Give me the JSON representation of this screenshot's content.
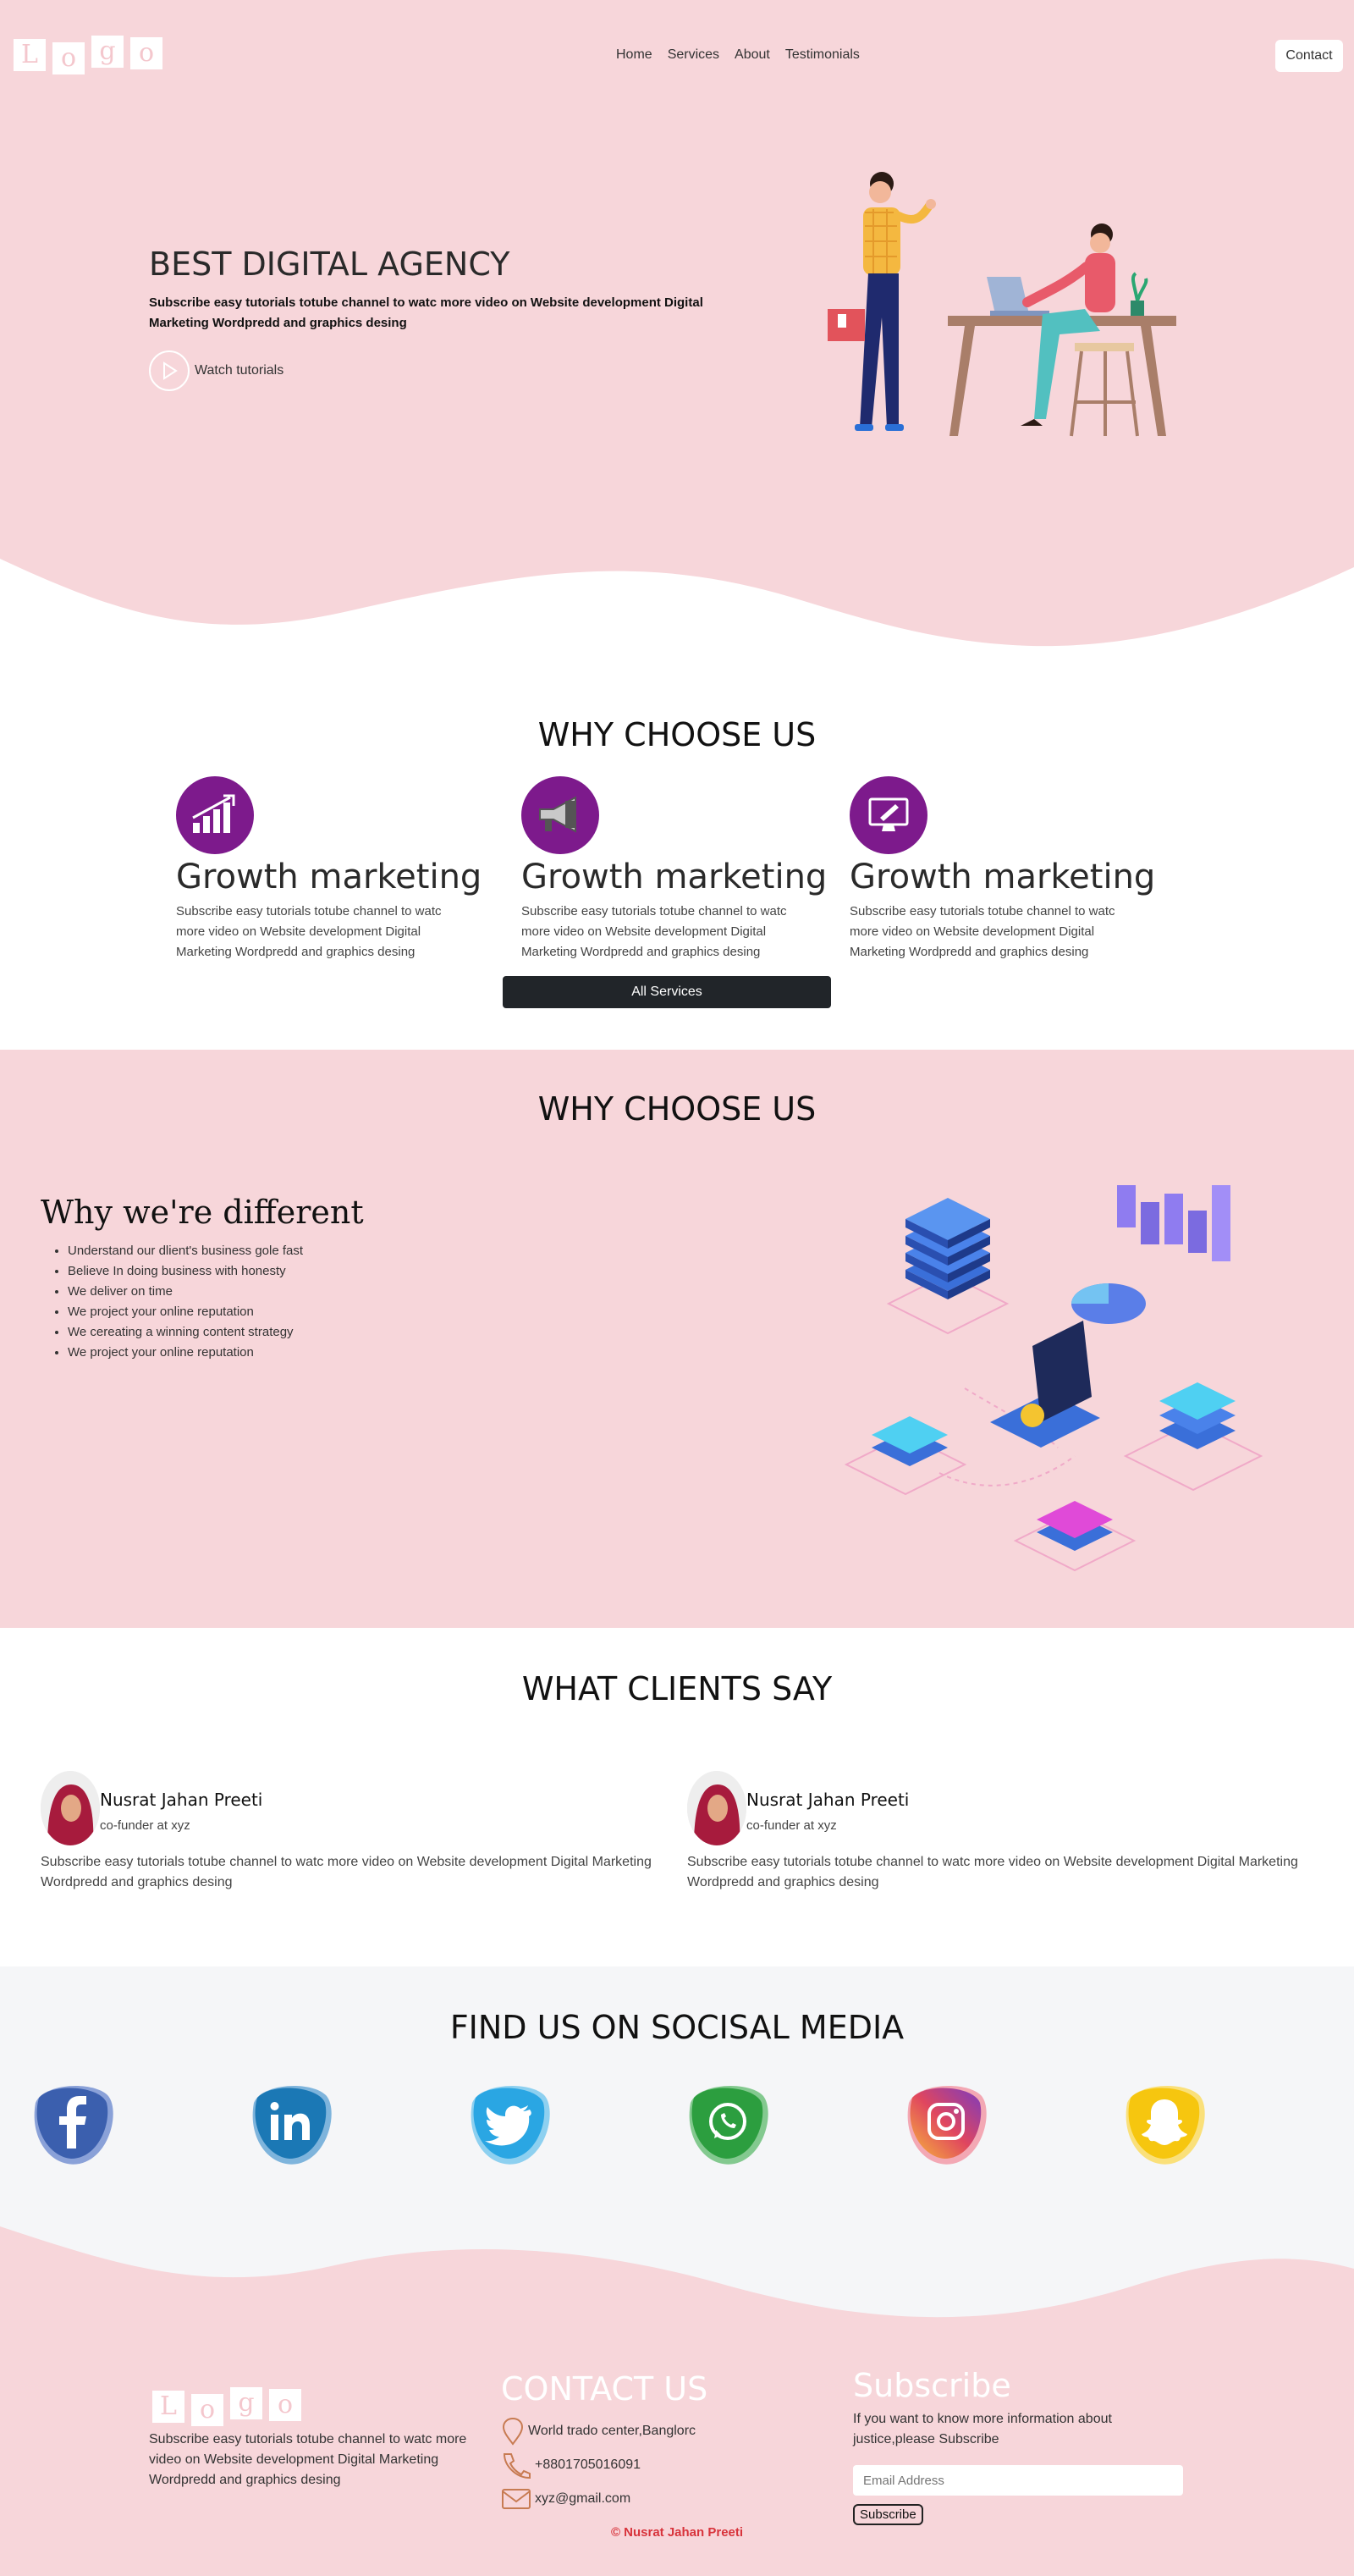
{
  "header": {
    "logo_letters": [
      "L",
      "o",
      "g",
      "o"
    ],
    "nav": [
      "Home",
      "Services",
      "About",
      "Testimonials"
    ],
    "contact_label": "Contact"
  },
  "hero": {
    "title": "BEST DIGITAL AGENCY",
    "subtitle": "Subscribe easy tutorials totube channel to watc more video on Website development Digital Marketing Wordpredd and graphics desing",
    "watch_label": "Watch tutorials"
  },
  "services": {
    "title": "WHY CHOOSE US",
    "items": [
      {
        "icon": "growth-chart-icon",
        "title": "Growth marketing",
        "text": "Subscribe easy tutorials totube channel to watc more video on Website development Digital Marketing Wordpredd and graphics desing"
      },
      {
        "icon": "megaphone-icon",
        "title": "Growth marketing",
        "text": "Subscribe easy tutorials totube channel to watc more video on Website development Digital Marketing Wordpredd and graphics desing"
      },
      {
        "icon": "monitor-pen-icon",
        "title": "Growth marketing",
        "text": "Subscribe easy tutorials totube channel to watc more video on Website development Digital Marketing Wordpredd and graphics desing"
      }
    ],
    "all_label": "All Services"
  },
  "different": {
    "section_title": "WHY CHOOSE US",
    "title": "Why we're different",
    "items": [
      "Understand our dlient's business gole fast",
      "Believe In doing business with honesty",
      "We deliver on time",
      "We project your online reputation",
      "We cereating a winning content strategy",
      "We project your online reputation"
    ]
  },
  "clients": {
    "title": "WHAT CLIENTS SAY",
    "items": [
      {
        "name": "Nusrat Jahan Preeti",
        "role": "co-funder at xyz",
        "text": "Subscribe easy tutorials totube channel to watc more video on Website development Digital Marketing Wordpredd and graphics desing"
      },
      {
        "name": "Nusrat Jahan Preeti",
        "role": "co-funder at xyz",
        "text": "Subscribe easy tutorials totube channel to watc more video on Website development Digital Marketing Wordpredd and graphics desing"
      }
    ]
  },
  "social": {
    "title": "FIND US ON SOCISAL MEDIA",
    "items": [
      {
        "icon": "facebook-icon",
        "color": "#3b5fae"
      },
      {
        "icon": "linkedin-icon",
        "color": "#1b78b5"
      },
      {
        "icon": "twitter-icon",
        "color": "#2aa6e3"
      },
      {
        "icon": "whatsapp-icon",
        "color": "#2c9e3f"
      },
      {
        "icon": "instagram-icon",
        "color": "#e0465f"
      },
      {
        "icon": "snapchat-icon",
        "color": "#f6c60f"
      }
    ]
  },
  "footer": {
    "about_text": "Subscribe easy tutorials totube channel to watc more video on Website development Digital Marketing Wordpredd and graphics desing",
    "contact_title": "CONTACT US",
    "address": "World trado center,Banglorc",
    "phone": "+8801705016091",
    "email": "xyz@gmail.com",
    "subscribe_title": "Subscribe",
    "subscribe_text": "If you want to know more information about justice,please Subscribe",
    "email_placeholder": "Email Address",
    "subscribe_label": "Subscribe",
    "copyright": "© Nusrat Jahan Preeti"
  },
  "colors": {
    "pink": "#f7d6da",
    "purple": "#7d1a8c",
    "dark_button": "#212529",
    "copyright_red": "#d8333b"
  }
}
